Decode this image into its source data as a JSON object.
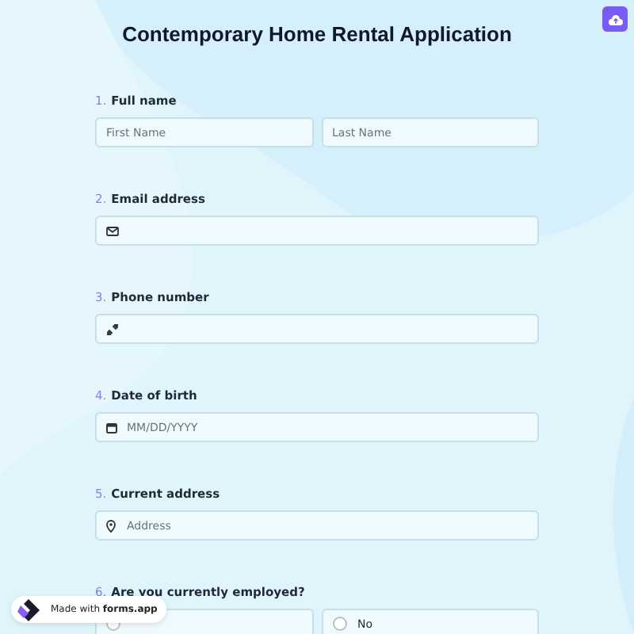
{
  "title": "Contemporary Home Rental Application",
  "questions": [
    {
      "number": "1.",
      "label": "Full name",
      "kind": "name",
      "fields": [
        {
          "placeholder": "First Name"
        },
        {
          "placeholder": "Last Name"
        }
      ]
    },
    {
      "number": "2.",
      "label": "Email address",
      "kind": "email"
    },
    {
      "number": "3.",
      "label": "Phone number",
      "kind": "phone"
    },
    {
      "number": "4.",
      "label": "Date of birth",
      "kind": "date",
      "placeholder": "MM/DD/YYYY"
    },
    {
      "number": "5.",
      "label": "Current address",
      "kind": "address",
      "placeholder": "Address"
    },
    {
      "number": "6.",
      "label": "Are you currently employed?",
      "kind": "choice",
      "options": [
        {
          "selected": false
        },
        {
          "label": "No",
          "selected": false
        }
      ]
    }
  ],
  "badge": {
    "text": "Made with **forms.app**"
  }
}
